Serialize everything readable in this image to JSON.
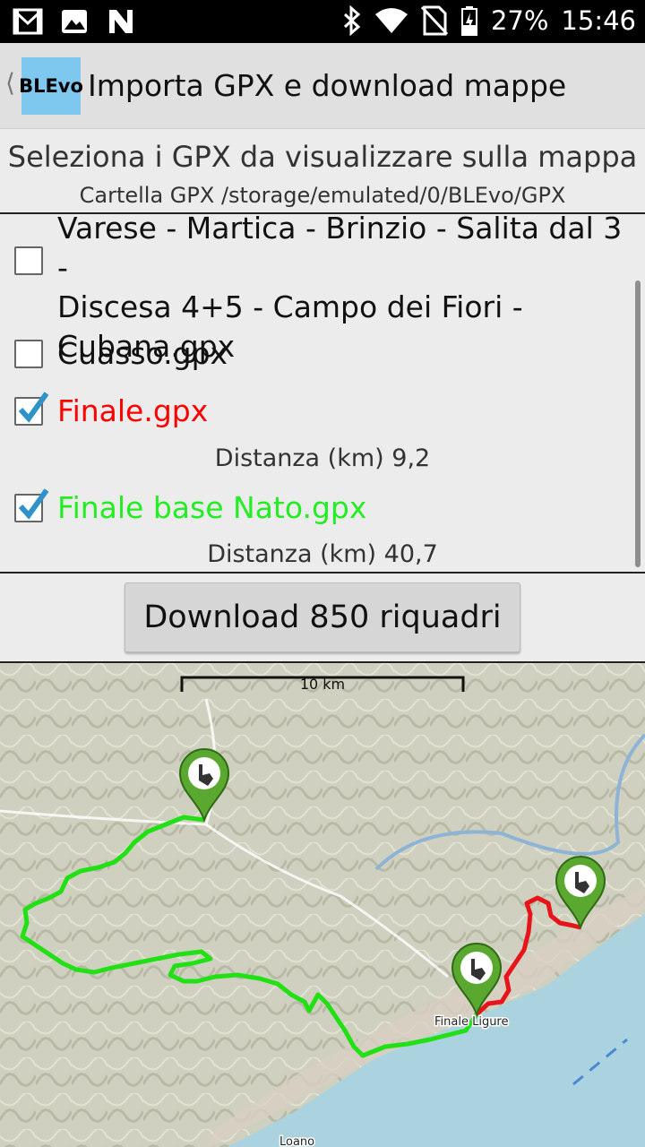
{
  "status_bar": {
    "icons_left": [
      "gmail-icon",
      "image-icon",
      "n-icon"
    ],
    "icons_right": [
      "bluetooth-icon",
      "wifi-icon",
      "no-sim-icon",
      "battery-icon"
    ],
    "battery": "27%",
    "time": "15:46"
  },
  "app_bar": {
    "logo_text": "BLEvo",
    "title": "Importa GPX e download mappe"
  },
  "subtitle": "Seleziona i GPX da visualizzare sulla mappa",
  "folder": "Cartella GPX /storage/emulated/0/BLEvo/GPX",
  "files": [
    {
      "name_lines": [
        "Varese - Martica - Brinzio - Salita dal 3 -",
        "Discesa 4+5 - Campo dei Fiori -",
        "Cubana.gpx"
      ],
      "checked": false,
      "color": "#111111",
      "distance": ""
    },
    {
      "name_lines": [
        "Cuasso.gpx"
      ],
      "checked": false,
      "color": "#111111",
      "distance": ""
    },
    {
      "name_lines": [
        "Finale.gpx"
      ],
      "checked": true,
      "color": "#ff0000",
      "distance": "Distanza (km) 9,2"
    },
    {
      "name_lines": [
        "Finale base Nato.gpx"
      ],
      "checked": true,
      "color": "#22ee22",
      "distance": "Distanza (km) 40,7"
    }
  ],
  "download_button": "Download 850 riquadri",
  "map": {
    "scale_label": "10 km",
    "place_labels": [
      "Finale Ligure",
      "Loano"
    ],
    "track_colors": {
      "red": "#e8141c",
      "green": "#22e016"
    }
  }
}
